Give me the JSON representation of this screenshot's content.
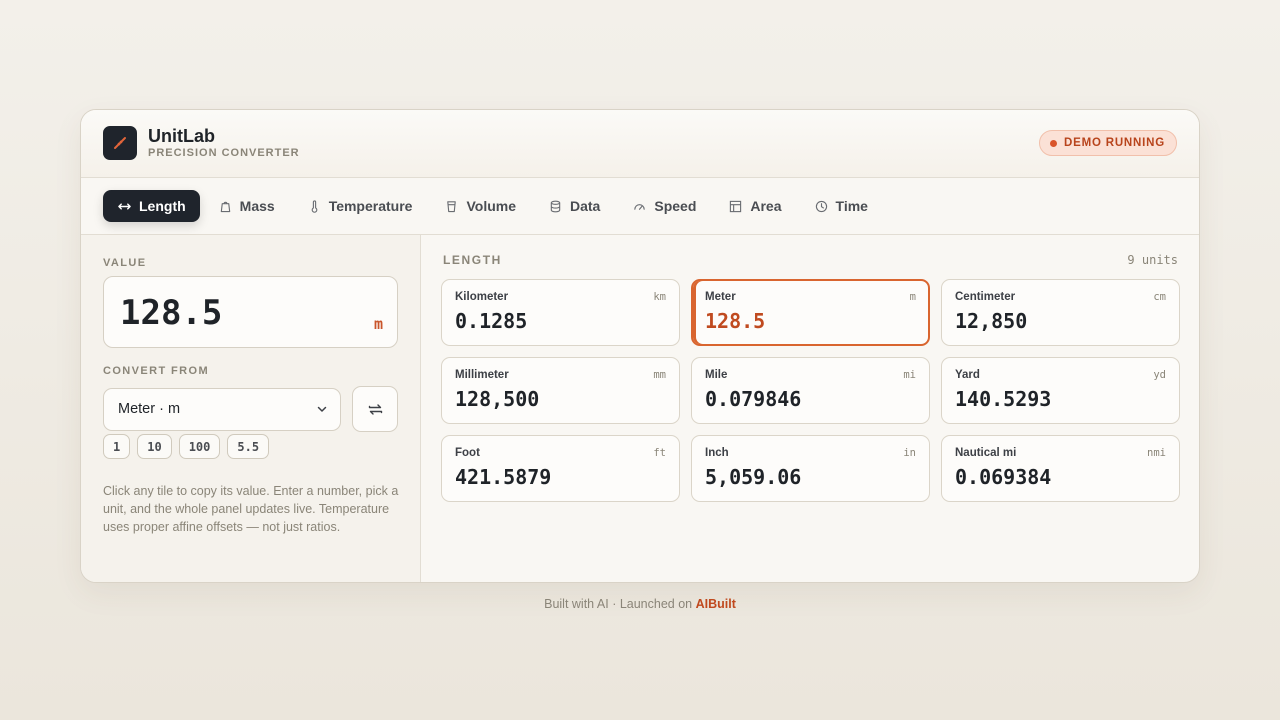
{
  "app": {
    "name": "UnitLab",
    "subtitle": "PRECISION CONVERTER",
    "status_badge": "DEMO RUNNING",
    "accent_color": "#d9542a"
  },
  "tabs": [
    {
      "label": "Length",
      "icon": "arrows-horizontal-icon",
      "active": true
    },
    {
      "label": "Mass",
      "icon": "weight-icon",
      "active": false
    },
    {
      "label": "Temperature",
      "icon": "thermometer-icon",
      "active": false
    },
    {
      "label": "Volume",
      "icon": "cup-icon",
      "active": false
    },
    {
      "label": "Data",
      "icon": "database-icon",
      "active": false
    },
    {
      "label": "Speed",
      "icon": "gauge-icon",
      "active": false
    },
    {
      "label": "Area",
      "icon": "grid-icon",
      "active": false
    },
    {
      "label": "Time",
      "icon": "clock-icon",
      "active": false
    }
  ],
  "input": {
    "label": "VALUE",
    "value": "128.5",
    "unit": "m",
    "convert_label": "CONVERT FROM",
    "selected_unit": "Meter · m",
    "presets": [
      "1",
      "10",
      "100",
      "5.5"
    ],
    "help_text": "Click any tile to copy its value. Enter a number, pick a unit, and the whole panel updates live. Temperature uses proper affine offsets — not just ratios."
  },
  "results": {
    "title": "LENGTH",
    "count": "9 units",
    "tiles": [
      {
        "name": "Kilometer",
        "abbr": "km",
        "value": "0.1285",
        "selected": false
      },
      {
        "name": "Meter",
        "abbr": "m",
        "value": "128.5",
        "selected": true
      },
      {
        "name": "Centimeter",
        "abbr": "cm",
        "value": "12,850",
        "selected": false
      },
      {
        "name": "Millimeter",
        "abbr": "mm",
        "value": "128,500",
        "selected": false
      },
      {
        "name": "Mile",
        "abbr": "mi",
        "value": "0.079846",
        "selected": false
      },
      {
        "name": "Yard",
        "abbr": "yd",
        "value": "140.5293",
        "selected": false
      },
      {
        "name": "Foot",
        "abbr": "ft",
        "value": "421.5879",
        "selected": false
      },
      {
        "name": "Inch",
        "abbr": "in",
        "value": "5,059.06",
        "selected": false
      },
      {
        "name": "Nautical mi",
        "abbr": "nmi",
        "value": "0.069384",
        "selected": false
      }
    ]
  },
  "footer": {
    "text": "Built with AI · Launched on ",
    "link": "AIBuilt"
  }
}
